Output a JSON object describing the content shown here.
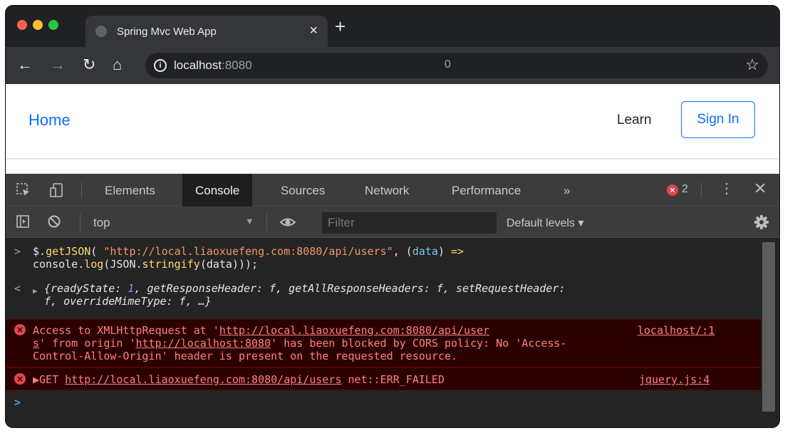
{
  "browser": {
    "tab_title": "Spring Mvc Web App",
    "tab_close": "×",
    "new_tab": "+",
    "url_host": "localhost",
    "url_port": ":8080",
    "url_stray": "0",
    "traffic_colors": {
      "close": "#ff5f57",
      "minimize": "#febc2e",
      "zoom": "#28c840"
    }
  },
  "page": {
    "home_link": "Home",
    "learn_link": "Learn",
    "signin_button": "Sign In"
  },
  "devtools": {
    "tabs": [
      "Elements",
      "Console",
      "Sources",
      "Network",
      "Performance"
    ],
    "more_tabs": "»",
    "error_count": "2",
    "context": "top",
    "filter_placeholder": "Filter",
    "levels": "Default levels ▾",
    "console": {
      "input_line1_a": "$.",
      "input_line1_fn": "getJSON",
      "input_line1_b": "( ",
      "input_line1_str": "\"http://local.liaoxuefeng.com:8080/api/users\"",
      "input_line1_c": ", (",
      "input_line1_param": "data",
      "input_line1_d": ") ",
      "input_line1_arrow": "=>",
      "input_line2_a": "console.",
      "input_line2_fn": "log",
      "input_line2_b": "(JSON.",
      "input_line2_fn2": "stringify",
      "input_line2_c": "(data)));",
      "result_line1_a": "{readyState: ",
      "result_line1_num": "1",
      "result_line1_b": ", getResponseHeader: f, getAllResponseHeaders: f, setRequestHeader:",
      "result_line2": "f, overrideMimeType: f, …}",
      "error1_line1_a": "Access to XMLHttpRequest at '",
      "error1_line1_link": "http://local.liaoxuefeng.com:8080/api/user",
      "error1_source": "localhost/:1",
      "error1_line2_link": "s",
      "error1_line2_a": "' from origin '",
      "error1_line2_link2": "http://localhost:8080",
      "error1_line2_b": "' has been blocked by CORS policy: No 'Access-",
      "error1_line3": "Control-Allow-Origin' header is present on the requested resource.",
      "error2_a": "▶GET ",
      "error2_link": "http://local.liaoxuefeng.com:8080/api/users",
      "error2_b": " net::ERR_FAILED",
      "error2_source": "jquery.js:4",
      "prompt_in": ">",
      "prompt_out": "<",
      "prompt_final": ">"
    }
  }
}
